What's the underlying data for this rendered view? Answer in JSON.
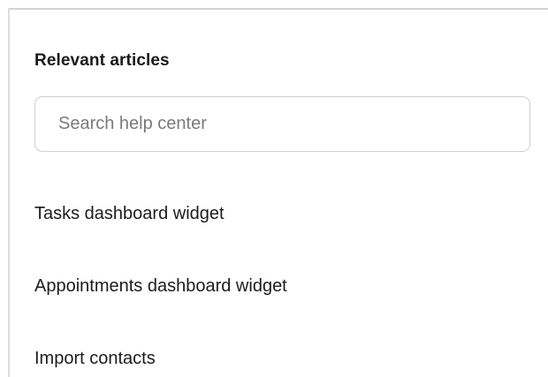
{
  "help_panel": {
    "title": "Relevant articles",
    "search": {
      "placeholder": "Search help center",
      "value": ""
    },
    "articles": [
      {
        "label": "Tasks dashboard widget"
      },
      {
        "label": "Appointments dashboard widget"
      },
      {
        "label": "Import contacts"
      }
    ]
  },
  "colors": {
    "text": "#1c1c1c",
    "placeholder": "#7a7a7a",
    "input_border": "#cfcfcf",
    "panel_border": "#d2d2d2"
  }
}
